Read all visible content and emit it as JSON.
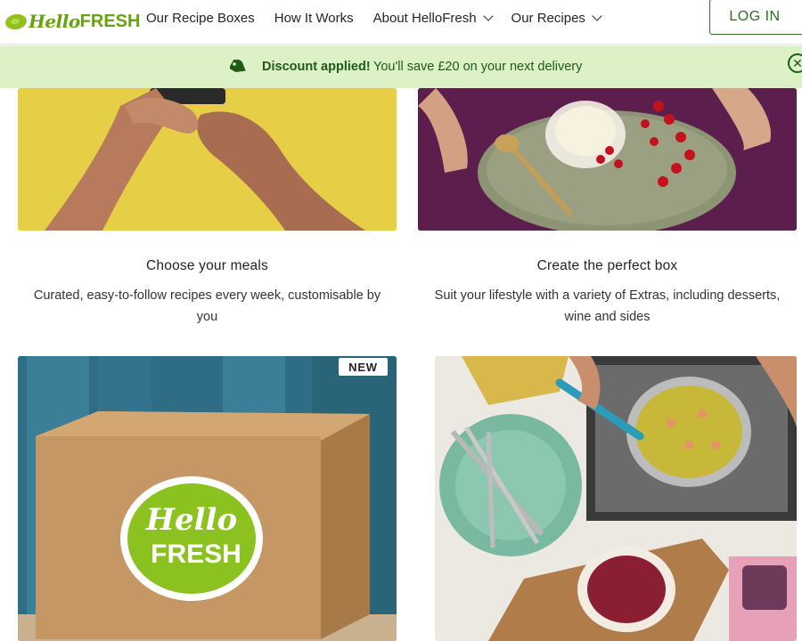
{
  "header": {
    "logo": {
      "hello": "Hello",
      "fresh": "FRESH"
    },
    "nav": [
      {
        "label": "Our Recipe Boxes",
        "dropdown": false
      },
      {
        "label": "How It Works",
        "dropdown": false
      },
      {
        "label": "About HelloFresh",
        "dropdown": true
      },
      {
        "label": "Our Recipes",
        "dropdown": true
      }
    ],
    "login_label": "LOG IN"
  },
  "banner": {
    "strong": "Discount applied!",
    "text": "You'll save £20 on your next delivery",
    "close_glyph": "✕",
    "icon": "tag-icon"
  },
  "cards": [
    {
      "title": "Choose your meals",
      "description": "Curated, easy-to-follow recipes every week, customisable by you"
    },
    {
      "title": "Create the perfect box",
      "description": "Suit your lifestyle with a variety of Extras, including desserts, wine and sides"
    }
  ],
  "badges": {
    "new": "NEW"
  },
  "box_logo": {
    "line1": "Hello",
    "line2": "FRESH"
  },
  "colors": {
    "brand_green": "#67a310",
    "banner_bg": "#dcf1c6",
    "banner_text": "#1f5a17",
    "login_border": "#3a6d2a"
  }
}
